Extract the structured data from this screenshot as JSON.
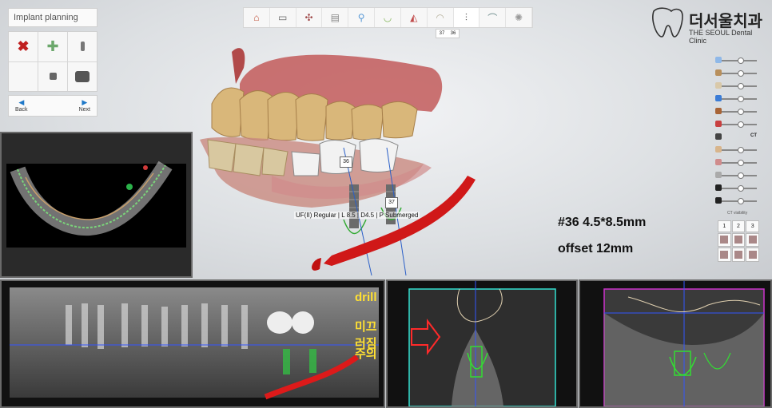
{
  "app": {
    "title": "Implant planning"
  },
  "tools": {
    "grid": [
      "delete-icon",
      "add-icon",
      "implant-icon",
      "abutment-icon",
      "sleeve-icon"
    ]
  },
  "nav": {
    "back_label": "Back",
    "next_label": "Next"
  },
  "toolbar": {
    "steps": [
      "home",
      "scan",
      "tools",
      "crown",
      "bone",
      "lips",
      "teeth",
      "implant",
      "sleeve",
      "rotate",
      "fit"
    ],
    "active_index": 7,
    "sub_tabs": [
      "37",
      "36"
    ]
  },
  "logo": {
    "korean": "더서울치과",
    "english": "THE SEOUL Dental Clinic",
    "mark": "The"
  },
  "viewer": {
    "implant_tag_1": "36",
    "implant_tag_2": "37",
    "implant_info": "UF(II) Regular | L 8.5 | D4.5 | P Submerged"
  },
  "notes": {
    "line1": "#36 4.5*8.5mm",
    "line2": "offset 12mm"
  },
  "sliders": {
    "items": [
      {
        "icon": "tooth-crown",
        "color": "#8fb8e8",
        "level": 0.55
      },
      {
        "icon": "tooth-bridge",
        "color": "#b88f5c",
        "level": 0.55
      },
      {
        "icon": "tooth-white",
        "color": "#d9c9a9",
        "level": 0.55
      },
      {
        "icon": "sleeve",
        "color": "#3b7cd6",
        "level": 0.55
      },
      {
        "icon": "cylinder",
        "color": "#a86436",
        "level": 0.55
      },
      {
        "icon": "nerve",
        "color": "#c84040",
        "level": 0.55
      },
      {
        "icon": "ct",
        "color": "#444444",
        "level": 0.55
      },
      {
        "icon": "tooth-beige",
        "color": "#d8b58c",
        "level": 0.55
      },
      {
        "icon": "gum",
        "color": "#d08c8c",
        "level": 0.55
      },
      {
        "icon": "upper-jaw",
        "color": "#aaaaaa",
        "level": 0.55
      },
      {
        "icon": "brightness",
        "color": "#222222",
        "level": 0.55
      },
      {
        "icon": "contrast",
        "color": "#222222",
        "level": 0.55
      }
    ],
    "ct_label": "CT",
    "ct_visibility_label": "CT visibility",
    "view_buttons": [
      "1",
      "2",
      "3"
    ]
  },
  "annotation": {
    "line1": "drill",
    "line2": "미끄러짐",
    "line3": "주의"
  }
}
